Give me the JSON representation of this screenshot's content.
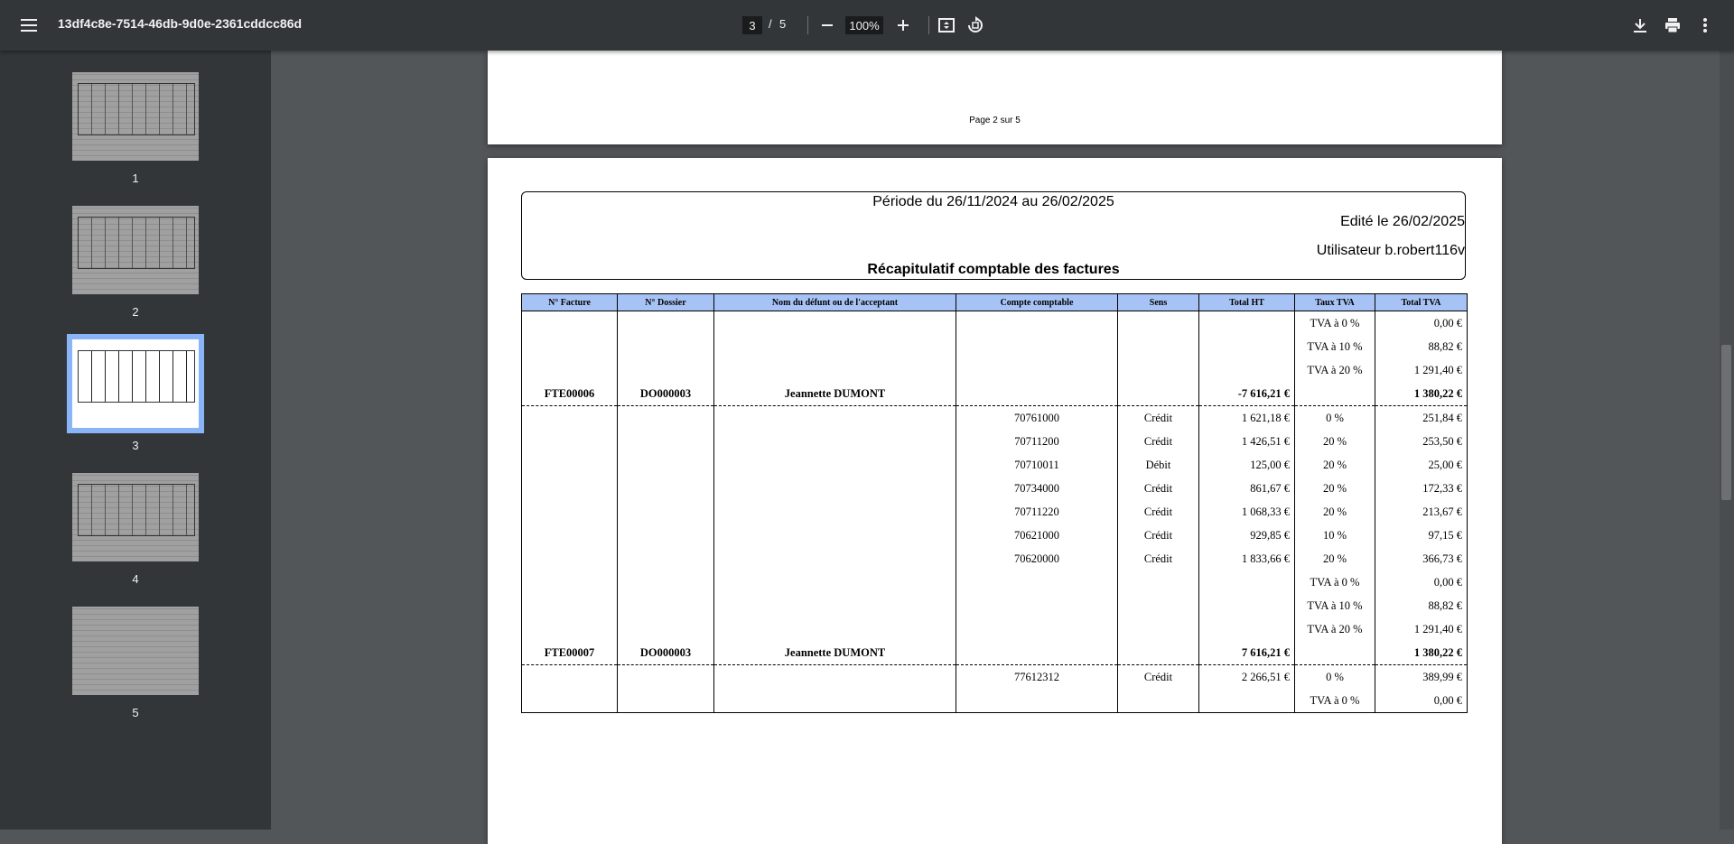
{
  "toolbar": {
    "title": "13df4c8e-7514-46db-9d0e-2361cddcc86d",
    "current_page": "3",
    "page_separator": "/",
    "total_pages": "5",
    "zoom": "100%"
  },
  "sidebar": {
    "thumbnails": [
      {
        "label": "1"
      },
      {
        "label": "2"
      },
      {
        "label": "3"
      },
      {
        "label": "4"
      },
      {
        "label": "5"
      }
    ],
    "selected": "3"
  },
  "previous_page": {
    "footer": "Page 2 sur 5"
  },
  "report": {
    "period": "Période du 26/11/2024 au 26/02/2025",
    "edited": "Edité le 26/02/2025",
    "user": "Utilisateur b.robert116v",
    "title": "Récapitulatif comptable des factures",
    "columns": [
      "N° Facture",
      "N° Dossier",
      "Nom du défunt ou de l'acceptant",
      "Compte comptable",
      "Sens",
      "Total HT",
      "Taux TVA",
      "Total TVA"
    ],
    "rows": [
      {
        "facture": "",
        "dossier": "",
        "nom": "",
        "compte": "",
        "sens": "",
        "ht": "",
        "taux": "TVA à 0 %",
        "tva": "0,00 €"
      },
      {
        "facture": "",
        "dossier": "",
        "nom": "",
        "compte": "",
        "sens": "",
        "ht": "",
        "taux": "TVA à 10 %",
        "tva": "88,82 €"
      },
      {
        "facture": "",
        "dossier": "",
        "nom": "",
        "compte": "",
        "sens": "",
        "ht": "",
        "taux": "TVA à 20 %",
        "tva": "1 291,40 €"
      },
      {
        "facture": "FTE00006",
        "dossier": "DO000003",
        "nom": "Jeannette DUMONT",
        "compte": "",
        "sens": "",
        "ht": "-7 616,21 €",
        "taux": "",
        "tva": "1 380,22 €"
      },
      {
        "facture": "",
        "dossier": "",
        "nom": "",
        "compte": "70761000",
        "sens": "Crédit",
        "ht": "1 621,18 €",
        "taux": "0 %",
        "tva": "251,84 €"
      },
      {
        "facture": "",
        "dossier": "",
        "nom": "",
        "compte": "70711200",
        "sens": "Crédit",
        "ht": "1 426,51 €",
        "taux": "20 %",
        "tva": "253,50 €"
      },
      {
        "facture": "",
        "dossier": "",
        "nom": "",
        "compte": "70710011",
        "sens": "Débit",
        "ht": "125,00 €",
        "taux": "20 %",
        "tva": "25,00 €"
      },
      {
        "facture": "",
        "dossier": "",
        "nom": "",
        "compte": "70734000",
        "sens": "Crédit",
        "ht": "861,67 €",
        "taux": "20 %",
        "tva": "172,33 €"
      },
      {
        "facture": "",
        "dossier": "",
        "nom": "",
        "compte": "70711220",
        "sens": "Crédit",
        "ht": "1 068,33 €",
        "taux": "20 %",
        "tva": "213,67 €"
      },
      {
        "facture": "",
        "dossier": "",
        "nom": "",
        "compte": "70621000",
        "sens": "Crédit",
        "ht": "929,85 €",
        "taux": "10 %",
        "tva": "97,15 €"
      },
      {
        "facture": "",
        "dossier": "",
        "nom": "",
        "compte": "70620000",
        "sens": "Crédit",
        "ht": "1 833,66 €",
        "taux": "20 %",
        "tva": "366,73 €"
      },
      {
        "facture": "",
        "dossier": "",
        "nom": "",
        "compte": "",
        "sens": "",
        "ht": "",
        "taux": "TVA à 0 %",
        "tva": "0,00 €"
      },
      {
        "facture": "",
        "dossier": "",
        "nom": "",
        "compte": "",
        "sens": "",
        "ht": "",
        "taux": "TVA à 10 %",
        "tva": "88,82 €"
      },
      {
        "facture": "",
        "dossier": "",
        "nom": "",
        "compte": "",
        "sens": "",
        "ht": "",
        "taux": "TVA à 20 %",
        "tva": "1 291,40 €"
      },
      {
        "facture": "FTE00007",
        "dossier": "DO000003",
        "nom": "Jeannette DUMONT",
        "compte": "",
        "sens": "",
        "ht": "7 616,21 €",
        "taux": "",
        "tva": "1 380,22 €"
      },
      {
        "facture": "",
        "dossier": "",
        "nom": "",
        "compte": "77612312",
        "sens": "Crédit",
        "ht": "2 266,51 €",
        "taux": "0 %",
        "tva": "389,99 €"
      },
      {
        "facture": "",
        "dossier": "",
        "nom": "",
        "compte": "",
        "sens": "",
        "ht": "",
        "taux": "TVA à 0 %",
        "tva": "0,00 €"
      }
    ]
  }
}
